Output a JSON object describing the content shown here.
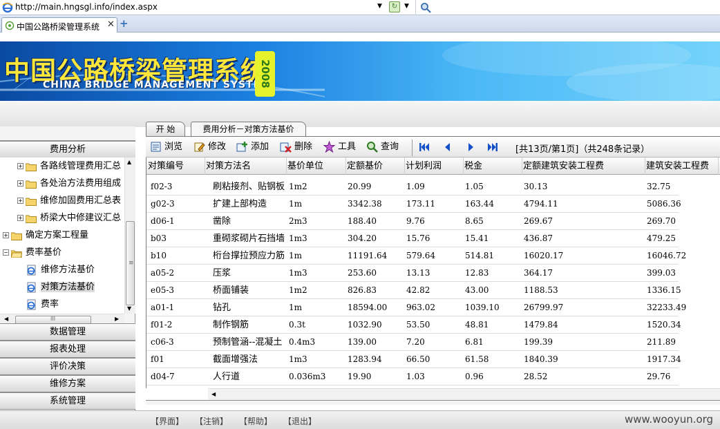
{
  "browser": {
    "url": "http://main.hngsgl.info/index.aspx",
    "tab_title": "中国公路桥梁管理系统",
    "tab_close": "✕",
    "new_tab": "+"
  },
  "banner": {
    "title": "中国公路桥梁管理系统",
    "subtitle": "CHINA BRIDGE MANAGEMENT SYSTEM",
    "year": "2008"
  },
  "left_panel": {
    "top_section": "费用分析",
    "tree": [
      {
        "label": "各路线管理费用汇总",
        "level": 1,
        "type": "folder",
        "expander": "+"
      },
      {
        "label": "各处治方法费用组成",
        "level": 1,
        "type": "folder",
        "expander": "+"
      },
      {
        "label": "维修加固费用汇总表",
        "level": 1,
        "type": "folder",
        "expander": "+"
      },
      {
        "label": "桥梁大中修建议汇总",
        "level": 1,
        "type": "folder",
        "expander": "+"
      },
      {
        "label": "确定方案工程量",
        "level": 0,
        "type": "folder",
        "expander": "+"
      },
      {
        "label": "费率基价",
        "level": 0,
        "type": "folder-open",
        "expander": "−"
      },
      {
        "label": "维修方法基价",
        "level": 1,
        "type": "page",
        "expander": ""
      },
      {
        "label": "对策方法基价",
        "level": 1,
        "type": "page",
        "expander": "",
        "selected": true
      },
      {
        "label": "费率",
        "level": 1,
        "type": "page",
        "expander": ""
      }
    ],
    "bottom_sections": [
      "数据管理",
      "报表处理",
      "评价决策",
      "维修方案",
      "系统管理"
    ]
  },
  "main": {
    "tabs": [
      "开 始",
      "费用分析－对策方法基价"
    ],
    "toolbar": {
      "browse": "浏览",
      "edit": "修改",
      "add": "添加",
      "delete": "删除",
      "tools": "工具",
      "query": "查询"
    },
    "page_info": "[共13页/第1页]（共248条记录）",
    "columns": [
      "对策编号",
      "对策方法名",
      "基价单位",
      "定额基价",
      "计划利润",
      "税金",
      "定额建筑安装工程费",
      "建筑安装工程费"
    ],
    "rows": [
      [
        "f02-3",
        "刷粘接剂、贴钢板",
        "1m2",
        "20.99",
        "1.09",
        "1.05",
        "30.13",
        "32.75"
      ],
      [
        "g02-3",
        "扩建上部构造",
        "1m",
        "3342.38",
        "173.11",
        "163.44",
        "4794.11",
        "5086.36"
      ],
      [
        "d06-1",
        "凿除",
        "2m3",
        "188.40",
        "9.76",
        "8.65",
        "269.67",
        "269.70"
      ],
      [
        "b03",
        "重砌浆砌片石挡墙",
        "1m3",
        "304.20",
        "15.76",
        "15.41",
        "436.87",
        "479.25"
      ],
      [
        "b10",
        "桁台撑拉预应力筋",
        "1m",
        "11191.64",
        "579.64",
        "514.81",
        "16020.17",
        "16046.72"
      ],
      [
        "a05-2",
        "压浆",
        "1m3",
        "253.60",
        "13.13",
        "12.83",
        "364.17",
        "399.03"
      ],
      [
        "e05-3",
        "桥面铺装",
        "1m2",
        "826.83",
        "42.82",
        "43.00",
        "1188.53",
        "1336.15"
      ],
      [
        "a01-1",
        "钻孔",
        "1m",
        "18594.00",
        "963.02",
        "1039.10",
        "26799.97",
        "32233.49"
      ],
      [
        "f01-2",
        "制作钢筋",
        "0.3t",
        "1032.90",
        "53.50",
        "48.81",
        "1479.84",
        "1520.34"
      ],
      [
        "c06-3",
        "预制管涵--混凝土",
        "0.4m3",
        "139.00",
        "7.20",
        "6.81",
        "199.39",
        "211.89"
      ],
      [
        "f01",
        "截面增强法",
        "1m3",
        "1283.94",
        "66.50",
        "61.58",
        "1840.39",
        "1917.34"
      ],
      [
        "d04-7",
        "人行道",
        "0.036m3",
        "19.90",
        "1.03",
        "0.96",
        "28.52",
        "29.76"
      ]
    ]
  },
  "footer": {
    "links": [
      "【界面】",
      "【注销】",
      "【帮助】",
      "【退出】"
    ],
    "watermark": "www.wooyun.org"
  },
  "colors": {
    "banner_dark": "#0a4aa3",
    "banner_light": "#74d3fb",
    "title_yellow": "#ffe63a",
    "year_badge": "#e6f22c",
    "nav_blue": "#1450c8"
  }
}
